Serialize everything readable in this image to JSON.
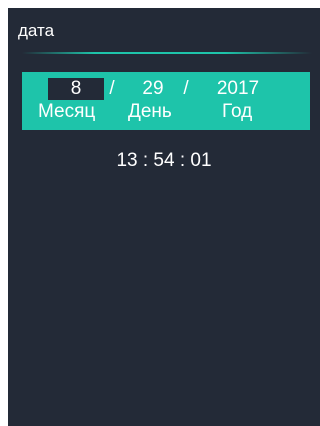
{
  "header": {
    "title": "дата"
  },
  "date": {
    "month": "8",
    "day": "29",
    "year": "2017",
    "separator": "/",
    "labels": {
      "month": "Месяц",
      "day": "День",
      "year": "Год"
    },
    "selected_field": "month"
  },
  "time": {
    "value": "13 : 54 : 01"
  },
  "colors": {
    "background": "#232a37",
    "accent": "#1ec4aa",
    "text": "#ffffff"
  }
}
